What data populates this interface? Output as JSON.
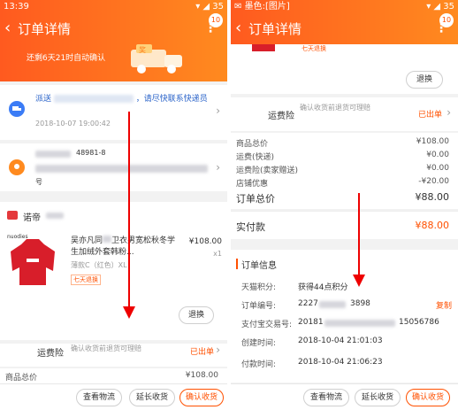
{
  "left": {
    "status": {
      "time": "13:39",
      "battery": "35"
    },
    "title": "订单详情",
    "badge": "10",
    "hero_text": "还剩6天21时自动确认",
    "truck_label": "奖",
    "delivery": {
      "text_a": "派送",
      "text_b": "，请尽快联系快递员",
      "time": "2018-10-07 19:00:42"
    },
    "address": {
      "phone_partial": "48981-8",
      "extra": "号"
    },
    "shop": {
      "name": "诺帝"
    },
    "product": {
      "title_a": "吴亦凡同",
      "title_b": "卫衣男宽松秋冬学生",
      "title_c": "加绒外套韩粉...",
      "sku": "薄款C（红色）XL",
      "price": "¥108.00",
      "qty": "x1",
      "tag": "七天退换",
      "image_brand": "nuodies"
    },
    "refund_button": "退换",
    "insurance": {
      "label": "运费险",
      "desc": "确认收货前退货可理赔",
      "status": "已出单"
    },
    "cut_row": {
      "label": "商品总价",
      "value": "¥108.00"
    },
    "bottom_buttons": [
      "查看物流",
      "延长收货",
      "确认收货"
    ]
  },
  "right": {
    "status": {
      "app": "墨色",
      "caption": "[图片]",
      "battery": "35"
    },
    "title": "订单详情",
    "badge": "10",
    "hero_tag": "七天退换",
    "refund_button": "退换",
    "insurance": {
      "label": "运费险",
      "desc": "确认收货前退货可理赔",
      "status": "已出单"
    },
    "price_rows": [
      {
        "label": "商品总价",
        "value": "¥108.00"
      },
      {
        "label": "运费(快递)",
        "value": "¥0.00"
      },
      {
        "label": "运费险(卖家赠送)",
        "value": "¥0.00"
      },
      {
        "label": "店铺优惠",
        "value": "-¥20.00"
      }
    ],
    "total": {
      "label": "订单总价",
      "value": "¥88.00"
    },
    "paid": {
      "label": "实付款",
      "value": "¥88.00"
    },
    "order_info": {
      "header": "订单信息",
      "rows": [
        {
          "label": "天猫积分:",
          "value": "获得44点积分"
        },
        {
          "label": "订单编号:",
          "value": "2227",
          "value_tail": "3898",
          "action": "复制"
        },
        {
          "label": "支付宝交易号:",
          "value": "20181",
          "value_tail": "15056786"
        },
        {
          "label": "创建时间:",
          "value": "2018-10-04 21:01:03"
        },
        {
          "label": "付款时间:",
          "value": "2018-10-04 21:06:23"
        }
      ]
    },
    "bottom_buttons": [
      "查看物流",
      "延长收货",
      "确认收货"
    ]
  },
  "colors": {
    "accent": "#ff5000",
    "arrow": "#e00000",
    "link": "#2a63c9"
  }
}
